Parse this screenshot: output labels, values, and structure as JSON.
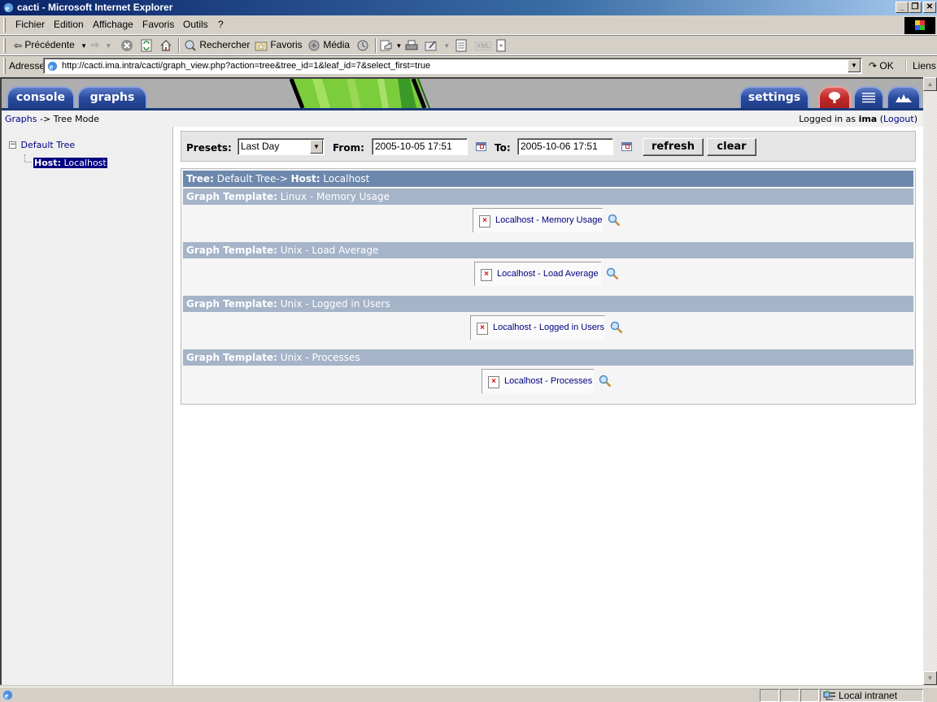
{
  "window": {
    "title": "cacti - Microsoft Internet Explorer",
    "controls": {
      "minimize": "_",
      "restore": "❐",
      "close": "✕"
    }
  },
  "menubar": {
    "items": [
      "Fichier",
      "Edition",
      "Affichage",
      "Favoris",
      "Outils",
      "?"
    ]
  },
  "toolbar": {
    "back_label": "Précédente",
    "search_label": "Rechercher",
    "favorites_label": "Favoris",
    "media_label": "Média"
  },
  "addressbar": {
    "label": "Adresse",
    "url": "http://cacti.ima.intra/cacti/graph_view.php?action=tree&tree_id=1&leaf_id=7&select_first=true",
    "go_label": "OK",
    "links_label": "Liens"
  },
  "cacti": {
    "tabs": {
      "console": "console",
      "graphs": "graphs",
      "settings": "settings"
    },
    "breadcrumb": {
      "link": "Graphs",
      "separator": "->",
      "current": "Tree Mode"
    },
    "login": {
      "prefix": "Logged in as",
      "user": "ima",
      "logout": "Logout"
    },
    "tree": {
      "root": "Default Tree",
      "expander": "−",
      "leaf_prefix": "Host:",
      "leaf_name": "Localhost"
    },
    "filter": {
      "presets_label": "Presets:",
      "preset_value": "Last Day",
      "from_label": "From:",
      "from_value": "2005-10-05 17:51",
      "to_label": "To:",
      "to_value": "2005-10-06 17:51",
      "refresh_label": "refresh",
      "clear_label": "clear"
    },
    "graph_header": {
      "tree_label": "Tree:",
      "tree_name": "Default Tree->",
      "host_label": "Host:",
      "host_name": "Localhost"
    },
    "template_label": "Graph Template:",
    "templates": [
      {
        "name": "Linux - Memory Usage",
        "graph": "Localhost - Memory Usage"
      },
      {
        "name": "Unix - Load Average",
        "graph": "Localhost - Load Average"
      },
      {
        "name": "Unix - Logged in Users",
        "graph": "Localhost - Logged in Users"
      },
      {
        "name": "Unix - Processes",
        "graph": "Localhost - Processes"
      }
    ]
  },
  "statusbar": {
    "zone": "Local intranet"
  }
}
